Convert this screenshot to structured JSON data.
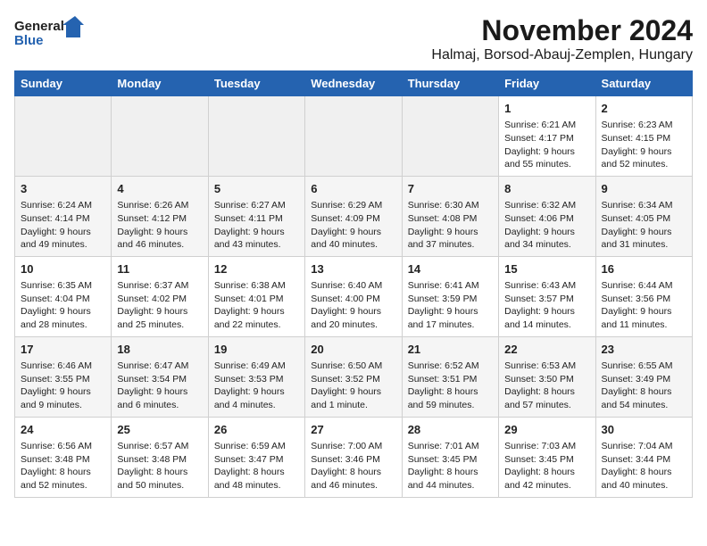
{
  "logo": {
    "line1": "General",
    "line2": "Blue"
  },
  "title": "November 2024",
  "subtitle": "Halmaj, Borsod-Abauj-Zemplen, Hungary",
  "days_of_week": [
    "Sunday",
    "Monday",
    "Tuesday",
    "Wednesday",
    "Thursday",
    "Friday",
    "Saturday"
  ],
  "weeks": [
    [
      {
        "day": "",
        "content": ""
      },
      {
        "day": "",
        "content": ""
      },
      {
        "day": "",
        "content": ""
      },
      {
        "day": "",
        "content": ""
      },
      {
        "day": "",
        "content": ""
      },
      {
        "day": "1",
        "content": "Sunrise: 6:21 AM\nSunset: 4:17 PM\nDaylight: 9 hours\nand 55 minutes."
      },
      {
        "day": "2",
        "content": "Sunrise: 6:23 AM\nSunset: 4:15 PM\nDaylight: 9 hours\nand 52 minutes."
      }
    ],
    [
      {
        "day": "3",
        "content": "Sunrise: 6:24 AM\nSunset: 4:14 PM\nDaylight: 9 hours\nand 49 minutes."
      },
      {
        "day": "4",
        "content": "Sunrise: 6:26 AM\nSunset: 4:12 PM\nDaylight: 9 hours\nand 46 minutes."
      },
      {
        "day": "5",
        "content": "Sunrise: 6:27 AM\nSunset: 4:11 PM\nDaylight: 9 hours\nand 43 minutes."
      },
      {
        "day": "6",
        "content": "Sunrise: 6:29 AM\nSunset: 4:09 PM\nDaylight: 9 hours\nand 40 minutes."
      },
      {
        "day": "7",
        "content": "Sunrise: 6:30 AM\nSunset: 4:08 PM\nDaylight: 9 hours\nand 37 minutes."
      },
      {
        "day": "8",
        "content": "Sunrise: 6:32 AM\nSunset: 4:06 PM\nDaylight: 9 hours\nand 34 minutes."
      },
      {
        "day": "9",
        "content": "Sunrise: 6:34 AM\nSunset: 4:05 PM\nDaylight: 9 hours\nand 31 minutes."
      }
    ],
    [
      {
        "day": "10",
        "content": "Sunrise: 6:35 AM\nSunset: 4:04 PM\nDaylight: 9 hours\nand 28 minutes."
      },
      {
        "day": "11",
        "content": "Sunrise: 6:37 AM\nSunset: 4:02 PM\nDaylight: 9 hours\nand 25 minutes."
      },
      {
        "day": "12",
        "content": "Sunrise: 6:38 AM\nSunset: 4:01 PM\nDaylight: 9 hours\nand 22 minutes."
      },
      {
        "day": "13",
        "content": "Sunrise: 6:40 AM\nSunset: 4:00 PM\nDaylight: 9 hours\nand 20 minutes."
      },
      {
        "day": "14",
        "content": "Sunrise: 6:41 AM\nSunset: 3:59 PM\nDaylight: 9 hours\nand 17 minutes."
      },
      {
        "day": "15",
        "content": "Sunrise: 6:43 AM\nSunset: 3:57 PM\nDaylight: 9 hours\nand 14 minutes."
      },
      {
        "day": "16",
        "content": "Sunrise: 6:44 AM\nSunset: 3:56 PM\nDaylight: 9 hours\nand 11 minutes."
      }
    ],
    [
      {
        "day": "17",
        "content": "Sunrise: 6:46 AM\nSunset: 3:55 PM\nDaylight: 9 hours\nand 9 minutes."
      },
      {
        "day": "18",
        "content": "Sunrise: 6:47 AM\nSunset: 3:54 PM\nDaylight: 9 hours\nand 6 minutes."
      },
      {
        "day": "19",
        "content": "Sunrise: 6:49 AM\nSunset: 3:53 PM\nDaylight: 9 hours\nand 4 minutes."
      },
      {
        "day": "20",
        "content": "Sunrise: 6:50 AM\nSunset: 3:52 PM\nDaylight: 9 hours\nand 1 minute."
      },
      {
        "day": "21",
        "content": "Sunrise: 6:52 AM\nSunset: 3:51 PM\nDaylight: 8 hours\nand 59 minutes."
      },
      {
        "day": "22",
        "content": "Sunrise: 6:53 AM\nSunset: 3:50 PM\nDaylight: 8 hours\nand 57 minutes."
      },
      {
        "day": "23",
        "content": "Sunrise: 6:55 AM\nSunset: 3:49 PM\nDaylight: 8 hours\nand 54 minutes."
      }
    ],
    [
      {
        "day": "24",
        "content": "Sunrise: 6:56 AM\nSunset: 3:48 PM\nDaylight: 8 hours\nand 52 minutes."
      },
      {
        "day": "25",
        "content": "Sunrise: 6:57 AM\nSunset: 3:48 PM\nDaylight: 8 hours\nand 50 minutes."
      },
      {
        "day": "26",
        "content": "Sunrise: 6:59 AM\nSunset: 3:47 PM\nDaylight: 8 hours\nand 48 minutes."
      },
      {
        "day": "27",
        "content": "Sunrise: 7:00 AM\nSunset: 3:46 PM\nDaylight: 8 hours\nand 46 minutes."
      },
      {
        "day": "28",
        "content": "Sunrise: 7:01 AM\nSunset: 3:45 PM\nDaylight: 8 hours\nand 44 minutes."
      },
      {
        "day": "29",
        "content": "Sunrise: 7:03 AM\nSunset: 3:45 PM\nDaylight: 8 hours\nand 42 minutes."
      },
      {
        "day": "30",
        "content": "Sunrise: 7:04 AM\nSunset: 3:44 PM\nDaylight: 8 hours\nand 40 minutes."
      }
    ]
  ]
}
